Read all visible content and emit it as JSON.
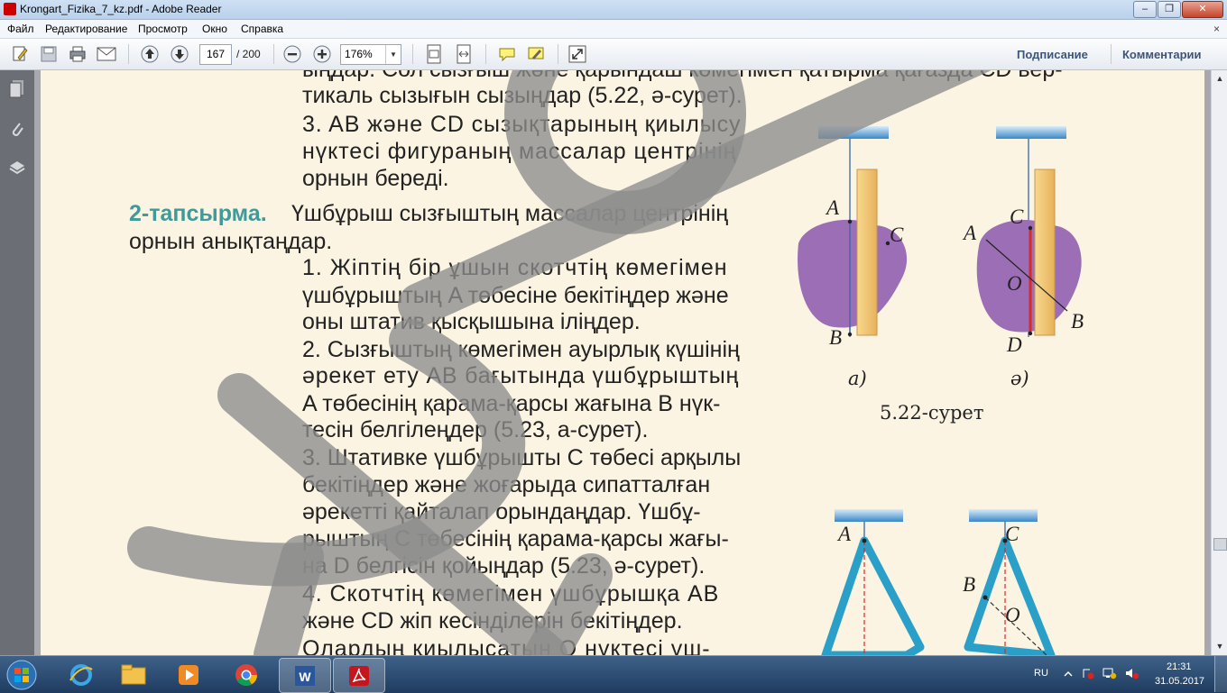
{
  "window": {
    "title": "Krongart_Fizika_7_kz.pdf - Adobe Reader",
    "buttons": [
      "–",
      "❐",
      "✕"
    ]
  },
  "menu": {
    "items": [
      "Файл",
      "Редактирование",
      "Просмотр",
      "Окно",
      "Справка"
    ],
    "close": "×"
  },
  "toolbar": {
    "page_current": "167",
    "page_total": "/ 200",
    "zoom": "176%",
    "sign_label": "Подписание",
    "comment_label": "Комментарии"
  },
  "document": {
    "lines": [
      "ыңдар. Сол сызғыш жәнe қарындаш көмегімен қатырма қағазда CD вер-",
      "тикаль сызығын сызыңдар (5.22, ә-сурет).",
      "3. AB және CD сызықтарының қиылысу",
      "нүктесі фигураның массалар центрінің",
      "орнын береді.",
      "2-тапсырма.",
      "Үшбұрыш сызғыштың массалар центрінің",
      "орнын анықтаңдар.",
      "1. Жіптің бір ұшын скотчтің көмегімен",
      "үшбұрыштың A төбесіне бекітіңдер және",
      "оны штатив қысқышына іліңдер.",
      "2. Сызғыштың көмегімен ауырлық күшінің",
      "әрекет ету AB бағытында үшбұрыштың",
      "A төбесінің қарама-қарсы жағына B нүк-",
      "тесін белгілеңдер (5.23, а-сурет).",
      "3. Штативке үшбұрышты C төбесі арқылы",
      "бекітіңдер және жоғарыда сипатталған",
      "әрекетті қайталап орындаңдар. Үшбұ-",
      "рыштың C төбесінің қарама-қарсы жағы-",
      "на D белгісін қойыңдар (5.23, ә-сурет).",
      "4. Скотчтің көмегімен үшбұрышқа AB",
      "және CD жіп кесінділерін бекітіңдер.",
      "Олардың қиылысатын O нүктесі үш-"
    ],
    "figure_522": {
      "labels_a": [
        "A",
        "C",
        "B"
      ],
      "labels_b": [
        "C",
        "A",
        "O",
        "B",
        "D"
      ],
      "sub_a": "а)",
      "sub_b": "ә)",
      "caption": "5.22-сурет"
    },
    "figure_523": {
      "labels_a": [
        "A"
      ],
      "labels_b": [
        "C",
        "B",
        "O"
      ]
    }
  },
  "taskbar": {
    "lang": "RU",
    "time": "21:31",
    "date": "31.05.2017",
    "apps": [
      "file-explorer",
      "internet-explorer",
      "media-player",
      "chrome",
      "word",
      "adobe-reader"
    ]
  },
  "colors": {
    "blob": "#9b6eb5",
    "triangle": "#2aa0c8",
    "task_heading": "#3f9a9a",
    "watermark": "#8c8c8c"
  }
}
